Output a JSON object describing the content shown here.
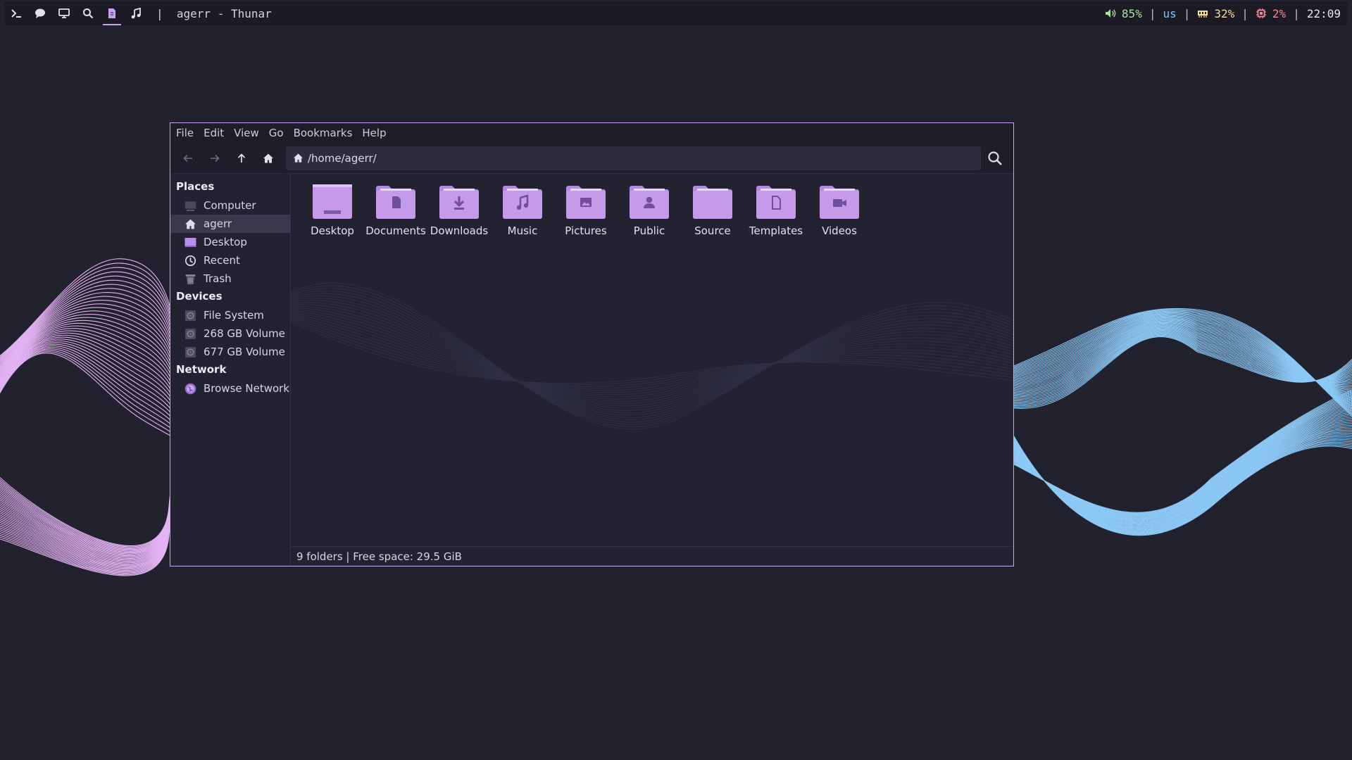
{
  "topbar": {
    "workspaces": [
      {
        "icon": "terminal-icon"
      },
      {
        "icon": "chat-icon"
      },
      {
        "icon": "monitor-icon"
      },
      {
        "icon": "search-icon"
      },
      {
        "icon": "file-icon",
        "active": true
      },
      {
        "icon": "music-icon"
      }
    ],
    "window_title": "|  agerr - Thunar",
    "status": {
      "volume": "85%",
      "keyboard_layout": "us",
      "memory": "32%",
      "cpu": "2%",
      "clock": "22:09"
    },
    "separator": "|"
  },
  "window": {
    "menu": [
      "File",
      "Edit",
      "View",
      "Go",
      "Bookmarks",
      "Help"
    ],
    "location_path": "/home/agerr/",
    "sidebar": {
      "places_title": "Places",
      "places": [
        {
          "label": "Computer",
          "icon": "computer-icon"
        },
        {
          "label": "agerr",
          "icon": "home-icon",
          "selected": true
        },
        {
          "label": "Desktop",
          "icon": "desktop-icon"
        },
        {
          "label": "Recent",
          "icon": "clock-icon"
        },
        {
          "label": "Trash",
          "icon": "trash-icon"
        }
      ],
      "devices_title": "Devices",
      "devices": [
        {
          "label": "File System",
          "icon": "drive-icon"
        },
        {
          "label": "268 GB Volume",
          "icon": "drive-icon"
        },
        {
          "label": "677 GB Volume",
          "icon": "drive-icon"
        }
      ],
      "network_title": "Network",
      "network": [
        {
          "label": "Browse Network",
          "icon": "network-icon"
        }
      ]
    },
    "folders": [
      {
        "label": "Desktop",
        "icon": "desktop-folder-icon"
      },
      {
        "label": "Documents",
        "icon": "documents-folder-icon"
      },
      {
        "label": "Downloads",
        "icon": "downloads-folder-icon"
      },
      {
        "label": "Music",
        "icon": "music-folder-icon"
      },
      {
        "label": "Pictures",
        "icon": "pictures-folder-icon"
      },
      {
        "label": "Public",
        "icon": "public-folder-icon"
      },
      {
        "label": "Source",
        "icon": "folder-icon"
      },
      {
        "label": "Templates",
        "icon": "templates-folder-icon"
      },
      {
        "label": "Videos",
        "icon": "videos-folder-icon"
      }
    ],
    "statusbar": "9 folders  |  Free space: 29.5 GiB"
  },
  "colors": {
    "background": "#22212e",
    "accent": "#c8a2f0",
    "folder": "#c59ae9",
    "wave_left": "#e3b3f3",
    "wave_right": "#8cc9f5"
  }
}
